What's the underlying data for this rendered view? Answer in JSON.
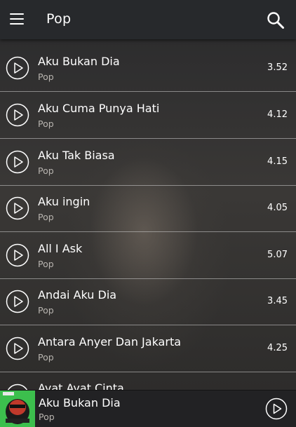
{
  "header": {
    "title": "Pop",
    "menu_icon": "hamburger-menu-icon",
    "search_icon": "search-icon"
  },
  "songs": [
    {
      "title": "Aku Bukan Dia",
      "genre": "Pop",
      "duration": "3.52"
    },
    {
      "title": "Aku Cuma Punya Hati",
      "genre": "Pop",
      "duration": "4.12"
    },
    {
      "title": "Aku Tak Biasa",
      "genre": "Pop",
      "duration": "4.15"
    },
    {
      "title": "Aku ingin",
      "genre": "Pop",
      "duration": "4.05"
    },
    {
      "title": "All I Ask",
      "genre": "Pop",
      "duration": "5.07"
    },
    {
      "title": "Andai Aku Dia",
      "genre": "Pop",
      "duration": "3.45"
    },
    {
      "title": "Antara Anyer Dan Jakarta",
      "genre": "Pop",
      "duration": "4.25"
    },
    {
      "title": "Ayat Ayat Cinta",
      "genre": "",
      "duration": ""
    }
  ],
  "now_playing": {
    "title": "Aku Bukan Dia",
    "genre": "Pop"
  },
  "colors": {
    "header_bg": "#27292c",
    "player_bg": "#222224",
    "album_green": "#36b34a"
  }
}
